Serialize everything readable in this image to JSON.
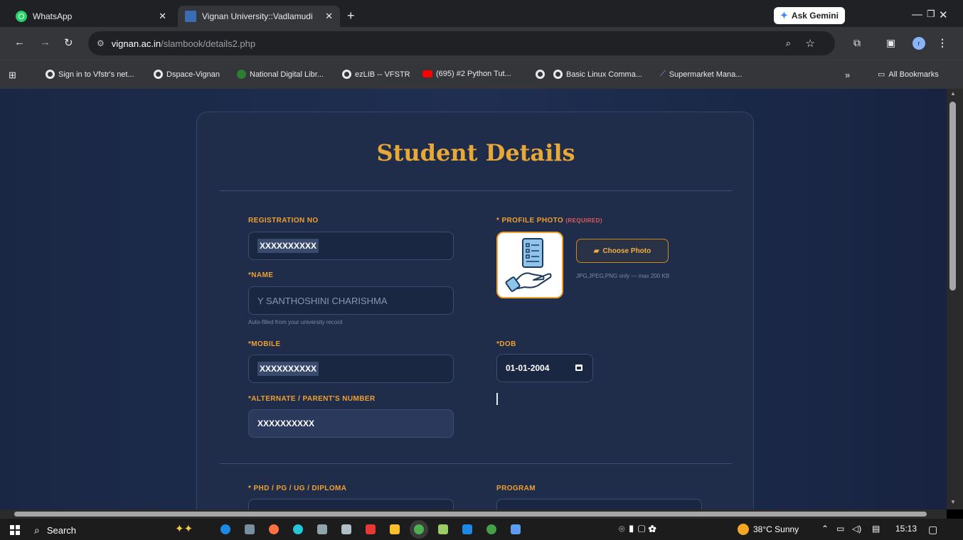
{
  "browser": {
    "tabs": [
      {
        "title": "WhatsApp",
        "icon": "whatsapp-icon"
      },
      {
        "title": "Vignan University::Vadlamudi",
        "icon": "vignan-favicon"
      }
    ],
    "gemini_label": "Ask Gemini",
    "url_host": "vignan.ac.in",
    "url_path": "/slambook/details2.php",
    "profile_initial": "r",
    "bookmarks": [
      "Sign in to Vfstr's net...",
      "Dspace-Vignan",
      "National Digital Libr...",
      "ezLIB -- VFSTR",
      "(695) #2 Python Tut...",
      "Basic Linux Comma...",
      "Supermarket Mana..."
    ],
    "all_bookmarks": "All Bookmarks"
  },
  "form": {
    "title": "Student Details",
    "registration_label": "REGISTRATION NO",
    "registration_value": "XXXXXXXXXX",
    "name_label": "*NAME",
    "name_value": "Y SANTHOSHINI CHARISHMA",
    "name_hint": "Auto-filled from your university record",
    "mobile_label": "*MOBILE",
    "mobile_value": "XXXXXXXXXX",
    "alternate_label": "*ALTERNATE / PARENT'S NUMBER",
    "alternate_value": "XXXXXXXXXX",
    "photo_label": "* PROFILE PHOTO",
    "photo_required": "(REQUIRED)",
    "choose_photo": "Choose Photo",
    "photo_hint": "JPG,JPEG,PNG only — max 200 KB",
    "dob_label": "*DOB",
    "dob_value": "01-01-2004",
    "level_label": "* PHD / PG / UG / DIPLOMA",
    "program_label": "PROGRAM"
  },
  "taskbar": {
    "search_label": "Search",
    "weather": "38°C  Sunny",
    "time": "15:13"
  }
}
